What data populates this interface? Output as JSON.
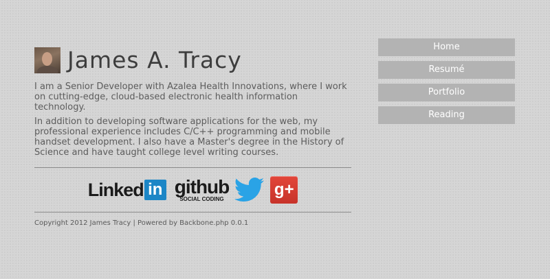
{
  "header": {
    "title": "James A. Tracy",
    "avatar_icon": "profile-photo"
  },
  "bio": {
    "paragraphs": [
      "I am a Senior Developer with Azalea Health Innovations, where I work on cutting-edge, cloud-based electronic health information technology.",
      "In addition to developing software applications for the web, my professional experience includes C/C++ programming and mobile handset development. I also have a Master's degree in the History of Science and have taught college level writing courses."
    ]
  },
  "social": {
    "linkedin": {
      "text": "Linked",
      "box": "in",
      "icon": "linkedin-logo"
    },
    "github": {
      "text": "github",
      "sub": "SOCIAL CODING",
      "icon": "github-logo"
    },
    "twitter": {
      "icon": "twitter-bird-icon"
    },
    "googleplus": {
      "text": "g+",
      "icon": "google-plus-icon"
    }
  },
  "footer": {
    "text": "Copyright 2012 James Tracy | Powered by Backbone.php 0.0.1"
  },
  "nav": {
    "items": [
      {
        "label": "Home"
      },
      {
        "label": "Resumé"
      },
      {
        "label": "Portfolio"
      },
      {
        "label": "Reading"
      }
    ]
  },
  "colors": {
    "background": "#d4d4d4",
    "nav_button": "#b3b3b3",
    "linkedin_blue": "#1c86c6",
    "twitter_blue": "#2aa3e6",
    "gplus_red": "#d23d31"
  }
}
